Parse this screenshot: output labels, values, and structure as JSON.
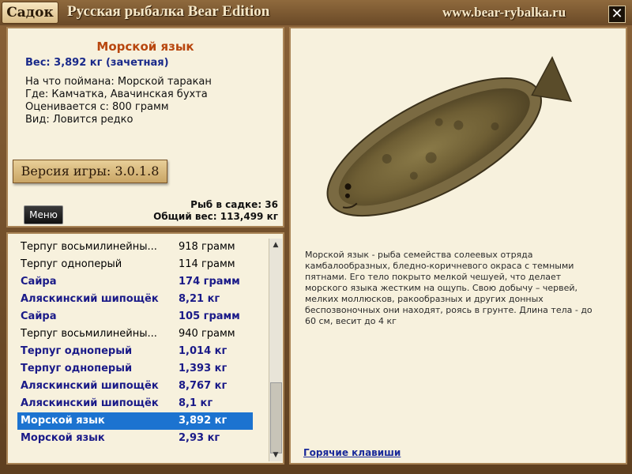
{
  "titlebar": {
    "sadok_label": "Садок",
    "app_title": "Русская рыбалка Bear Edition",
    "site": "www.bear-rybalka.ru",
    "close_label": "✕"
  },
  "fish": {
    "name": "Морской язык",
    "weight": "Вес: 3,892 кг (зачетная)",
    "caught_on": "На что поймана: Морской таракан",
    "where": "Где: Камчатка, Авачинская бухта",
    "valued_from": "Оценивается с: 800 грамм",
    "kind": "Вид: Ловится редко",
    "description": "Морской язык - рыба семейства солеевых отряда камбалообразных, бледно-коричневого окраса с темными пятнами. Его тело покрыто мелкой чешуей, что делает морского языка жестким на ощупь. Свою добычу – червей, мелких моллюсков, ракообразных и других донных беспозвоночных они находят, роясь в грунте. Длина тела - до 60 см, весит до 4 кг"
  },
  "version": "Версия игры: 3.0.1.8",
  "menu_label": "Меню",
  "stats": {
    "fish_count": "Рыб в садке: 36",
    "total_weight": "Общий вес: 113,499 кг"
  },
  "catch_list": [
    {
      "name": "Терпуг восьмилинейны...",
      "weight": "918 грамм",
      "bold": false,
      "selected": false
    },
    {
      "name": "Терпуг одноперый",
      "weight": "114 грамм",
      "bold": false,
      "selected": false
    },
    {
      "name": "Сайра",
      "weight": "174 грамм",
      "bold": true,
      "selected": false
    },
    {
      "name": "Аляскинский шипощёк",
      "weight": "8,21 кг",
      "bold": true,
      "selected": false
    },
    {
      "name": "Сайра",
      "weight": "105 грамм",
      "bold": true,
      "selected": false
    },
    {
      "name": "Терпуг восьмилинейны...",
      "weight": "940 грамм",
      "bold": false,
      "selected": false
    },
    {
      "name": "Терпуг одноперый",
      "weight": "1,014 кг",
      "bold": true,
      "selected": false
    },
    {
      "name": "Терпуг одноперый",
      "weight": "1,393 кг",
      "bold": true,
      "selected": false
    },
    {
      "name": "Аляскинский шипощёк",
      "weight": "8,767 кг",
      "bold": true,
      "selected": false
    },
    {
      "name": "Аляскинский шипощёк",
      "weight": "8,1 кг",
      "bold": true,
      "selected": false
    },
    {
      "name": "Морской язык",
      "weight": "3,892 кг",
      "bold": true,
      "selected": true
    },
    {
      "name": "Морской язык",
      "weight": "2,93 кг",
      "bold": true,
      "selected": false
    }
  ],
  "hotkeys_label": "Горячие клавиши",
  "scroll": {
    "up": "▲",
    "down": "▼"
  }
}
